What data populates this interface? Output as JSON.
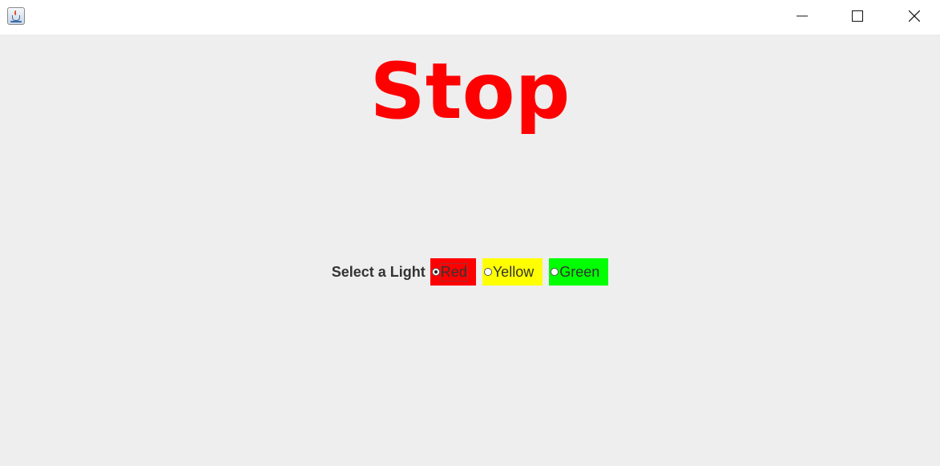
{
  "window": {
    "icon": "java-cup-icon"
  },
  "display": {
    "text": "Stop",
    "color": "#ff0000"
  },
  "selector": {
    "label": "Select a Light",
    "options": [
      {
        "label": "Red",
        "color": "#ff0000",
        "selected": true
      },
      {
        "label": "Yellow",
        "color": "#ffff00",
        "selected": false
      },
      {
        "label": "Green",
        "color": "#00ff00",
        "selected": false
      }
    ]
  }
}
